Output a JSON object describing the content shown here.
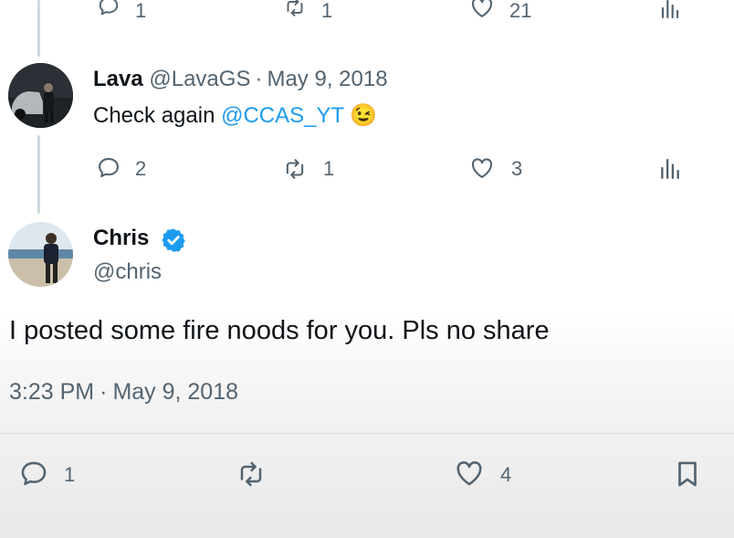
{
  "top_actions": {
    "reply_count": "1",
    "retweet_count": "1",
    "like_count": "21"
  },
  "reply": {
    "author_name": "Lava",
    "handle": "@LavaGS",
    "separator": "·",
    "date": "May 9, 2018",
    "text_prefix": "Check again ",
    "mention": "@CCAS_YT",
    "emoji": "😉",
    "actions": {
      "reply_count": "2",
      "retweet_count": "1",
      "like_count": "3"
    }
  },
  "main_tweet": {
    "author_name": "Chris",
    "handle": "@chris",
    "verified": true,
    "text": "I posted some fire noods for you. Pls no share",
    "time": "3:23 PM",
    "separator": "·",
    "date": "May 9, 2018",
    "actions": {
      "reply_count": "1",
      "like_count": "4"
    }
  },
  "colors": {
    "accent": "#1d9bf0",
    "muted": "#536471",
    "thread_line": "#cfd9de"
  }
}
